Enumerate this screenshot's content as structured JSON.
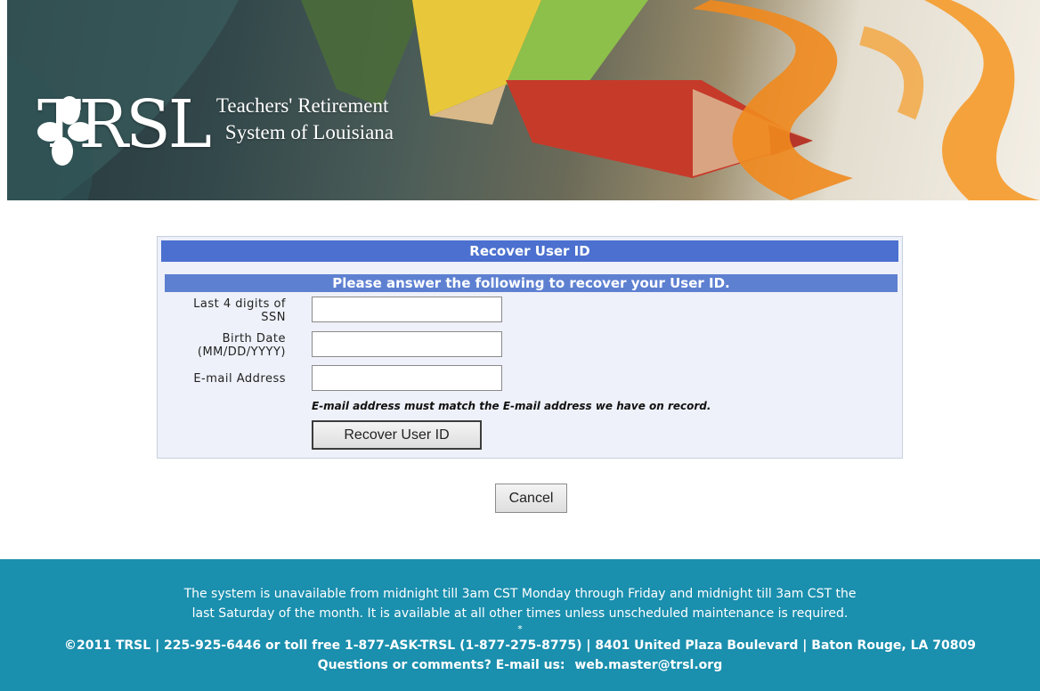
{
  "header": {
    "logo_word": "TRSL",
    "logo_line1": "Teachers' Retirement",
    "logo_line2": "System of Louisiana"
  },
  "form": {
    "title": "Recover User ID",
    "subtitle": "Please answer the following to recover your User ID.",
    "fields": [
      {
        "label_line1": "Last 4 digits of",
        "label_line2": "SSN",
        "value": "",
        "placeholder": ""
      },
      {
        "label_line1": "Birth Date",
        "label_line2": "(MM/DD/YYYY)",
        "value": "",
        "placeholder": ""
      },
      {
        "label_line1": "E-mail Address",
        "label_line2": "",
        "value": "",
        "placeholder": ""
      }
    ],
    "note": "E-mail address must match the E-mail address we have on record.",
    "submit_label": "Recover User ID"
  },
  "cancel_label": "Cancel",
  "footer": {
    "line1": "The system is unavailable from midnight till 3am CST Monday through Friday and midnight till 3am CST the",
    "line2": "last Saturday of the month.  It is available at all other times unless unscheduled maintenance is required.",
    "separator": "*",
    "copyright": "©2011 TRSL | 225-925-6446 or toll free 1-877-ASK-TRSL (1-877-275-8775) | 8401 United Plaza Boulevard | Baton Rouge, LA 70809",
    "contact_prefix": "Questions or comments? E-mail us:",
    "contact_email": "web.master@trsl.org"
  },
  "colors": {
    "panel_header": "#4b70cf",
    "panel_background": "#eef1f9",
    "footer_background": "#1a8fae"
  }
}
